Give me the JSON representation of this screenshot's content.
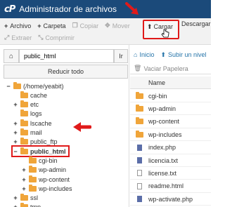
{
  "app": {
    "logo": "cP",
    "title": "Administrador de archivos"
  },
  "toolbar": {
    "row1": [
      {
        "icon": "plus-icon",
        "glyph": "+",
        "label": "Archivo",
        "enabled": true
      },
      {
        "icon": "plus-icon",
        "glyph": "+",
        "label": "Carpeta",
        "enabled": true
      },
      {
        "icon": "copy-icon",
        "glyph": "❐",
        "label": "Copiar",
        "enabled": false
      },
      {
        "icon": "move-icon",
        "glyph": "✥",
        "label": "Mover",
        "enabled": false
      }
    ],
    "upload": {
      "glyph": "⬆",
      "label": "Cargar"
    },
    "download_label": "Descargar",
    "row2": [
      {
        "icon": "extract-icon",
        "glyph": "⤢",
        "label": "Extraer",
        "enabled": false
      },
      {
        "icon": "compress-icon",
        "glyph": "⤡",
        "label": "Comprimir",
        "enabled": false
      }
    ]
  },
  "left_panel": {
    "path_value": "public_html",
    "go_label": "Ir",
    "collapse_label": "Reducir todo",
    "tree": [
      {
        "label": "(/home/yeabit)",
        "toggle": "−",
        "depth": 0,
        "root": true
      },
      {
        "label": "cache",
        "toggle": "",
        "depth": 1
      },
      {
        "label": "etc",
        "toggle": "+",
        "depth": 1
      },
      {
        "label": "logs",
        "toggle": "",
        "depth": 1
      },
      {
        "label": "lscache",
        "toggle": "+",
        "depth": 1
      },
      {
        "label": "mail",
        "toggle": "+",
        "depth": 1
      },
      {
        "label": "public_ftp",
        "toggle": "+",
        "depth": 1
      },
      {
        "label": "public_html",
        "toggle": "−",
        "depth": 1,
        "selected": true
      },
      {
        "label": "cgi-bin",
        "toggle": "",
        "depth": 2
      },
      {
        "label": "wp-admin",
        "toggle": "+",
        "depth": 2
      },
      {
        "label": "wp-content",
        "toggle": "+",
        "depth": 2
      },
      {
        "label": "wp-includes",
        "toggle": "+",
        "depth": 2
      },
      {
        "label": "ssl",
        "toggle": "+",
        "depth": 1
      },
      {
        "label": "tmp",
        "toggle": "+",
        "depth": 1
      }
    ]
  },
  "right_panel": {
    "nav_home": "Inicio",
    "nav_up": "Subir un nivel",
    "empty_trash": "Vaciar Papelera",
    "name_header": "Name",
    "files": [
      {
        "name": "cgi-bin",
        "type": "folder"
      },
      {
        "name": "wp-admin",
        "type": "folder"
      },
      {
        "name": "wp-content",
        "type": "folder"
      },
      {
        "name": "wp-includes",
        "type": "folder"
      },
      {
        "name": "index.php",
        "type": "php"
      },
      {
        "name": "licencia.txt",
        "type": "php"
      },
      {
        "name": "license.txt",
        "type": "doc"
      },
      {
        "name": "readme.html",
        "type": "doc"
      },
      {
        "name": "wp-activate.php",
        "type": "php"
      }
    ]
  },
  "colors": {
    "header_bg": "#1b4a7a",
    "highlight": "#e01a1a",
    "folder": "#f0a53a",
    "link": "#2574a9"
  }
}
